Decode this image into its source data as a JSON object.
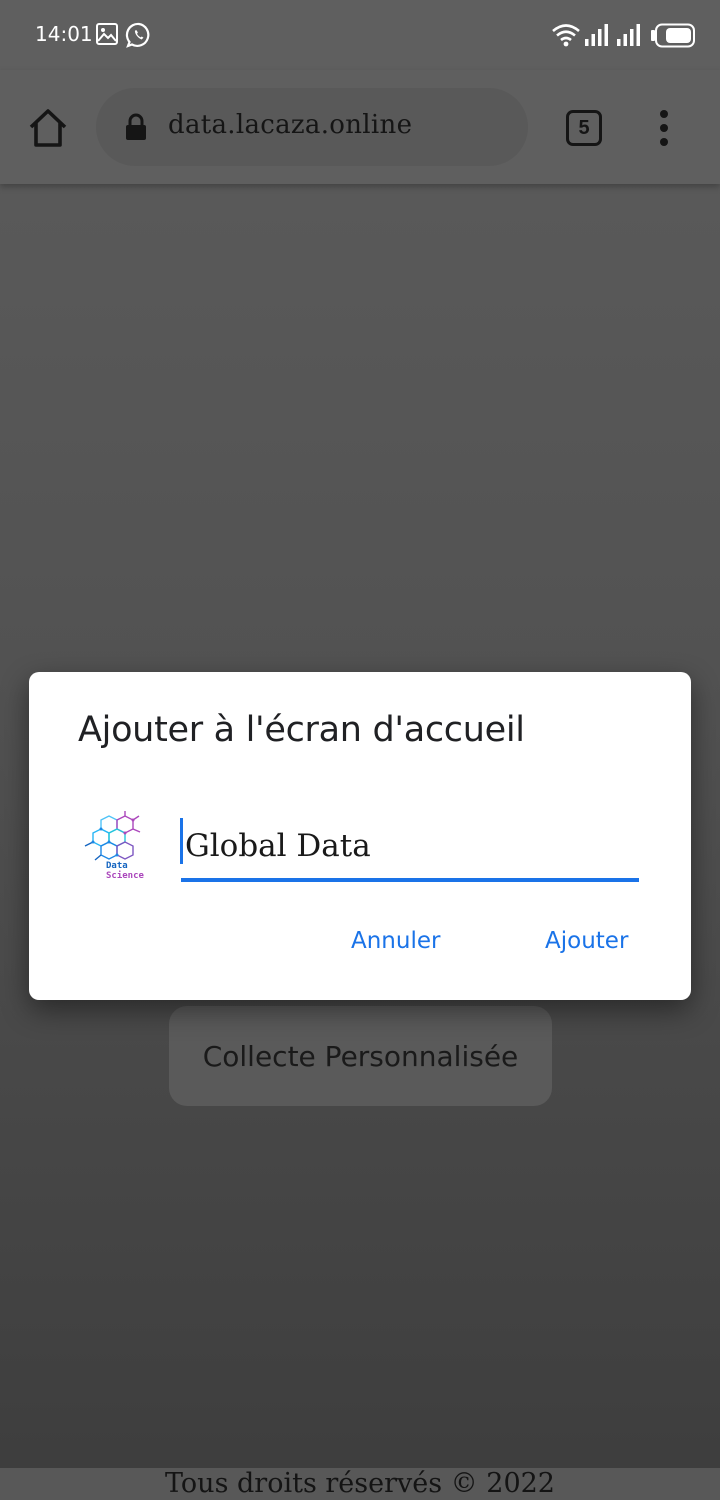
{
  "status_bar": {
    "time": "14:01",
    "icons": [
      "gallery-icon",
      "whatsapp-icon",
      "wifi-icon",
      "signal-icon",
      "signal-icon",
      "battery-icon"
    ]
  },
  "browser": {
    "url": "data.lacaza.online",
    "tab_count": "5",
    "icons": [
      "home-icon",
      "lock-icon",
      "overflow-menu-icon"
    ]
  },
  "page": {
    "collecte_button_label": "Collecte Personnalisée",
    "footer_text": "Tous droits réservés © 2022"
  },
  "dialog": {
    "title": "Ajouter à l'écran d'accueil",
    "app_icon_text_1": "Data",
    "app_icon_text_2": "Science",
    "name_value": "Global Data",
    "cancel_label": "Annuler",
    "add_label": "Ajouter"
  },
  "colors": {
    "accent": "#1a73e8",
    "scrim": "#525252",
    "dialog_bg": "#ffffff"
  }
}
